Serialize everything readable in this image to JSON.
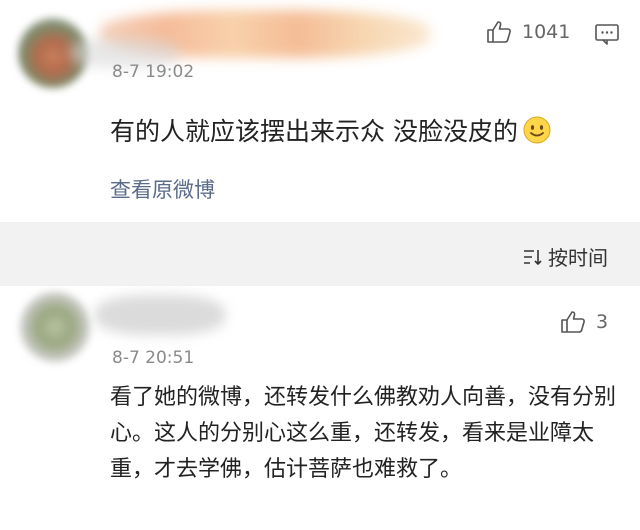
{
  "post": {
    "time": "8-7 19:02",
    "like_count": "1041",
    "text": "有的人就应该摆出来示众 没脸没皮的",
    "emoji": "smile-emoji",
    "view_original": "查看原微博",
    "icons": [
      "thumb-up-icon",
      "comment-icon"
    ]
  },
  "sort": {
    "label": "按时间",
    "icon": "sort-icon"
  },
  "comment": {
    "time": "8-7 20:51",
    "like_count": "3",
    "text": "看了她的微博，还转发什么佛教劝人向善，没有分别心。这人的分别心这么重，还转发，看来是业障太重，才去学佛，估计菩萨也难救了。"
  },
  "colors": {
    "link": "#5b6c8a",
    "band": "#f2f2f2",
    "meta": "#8a8a8a"
  }
}
